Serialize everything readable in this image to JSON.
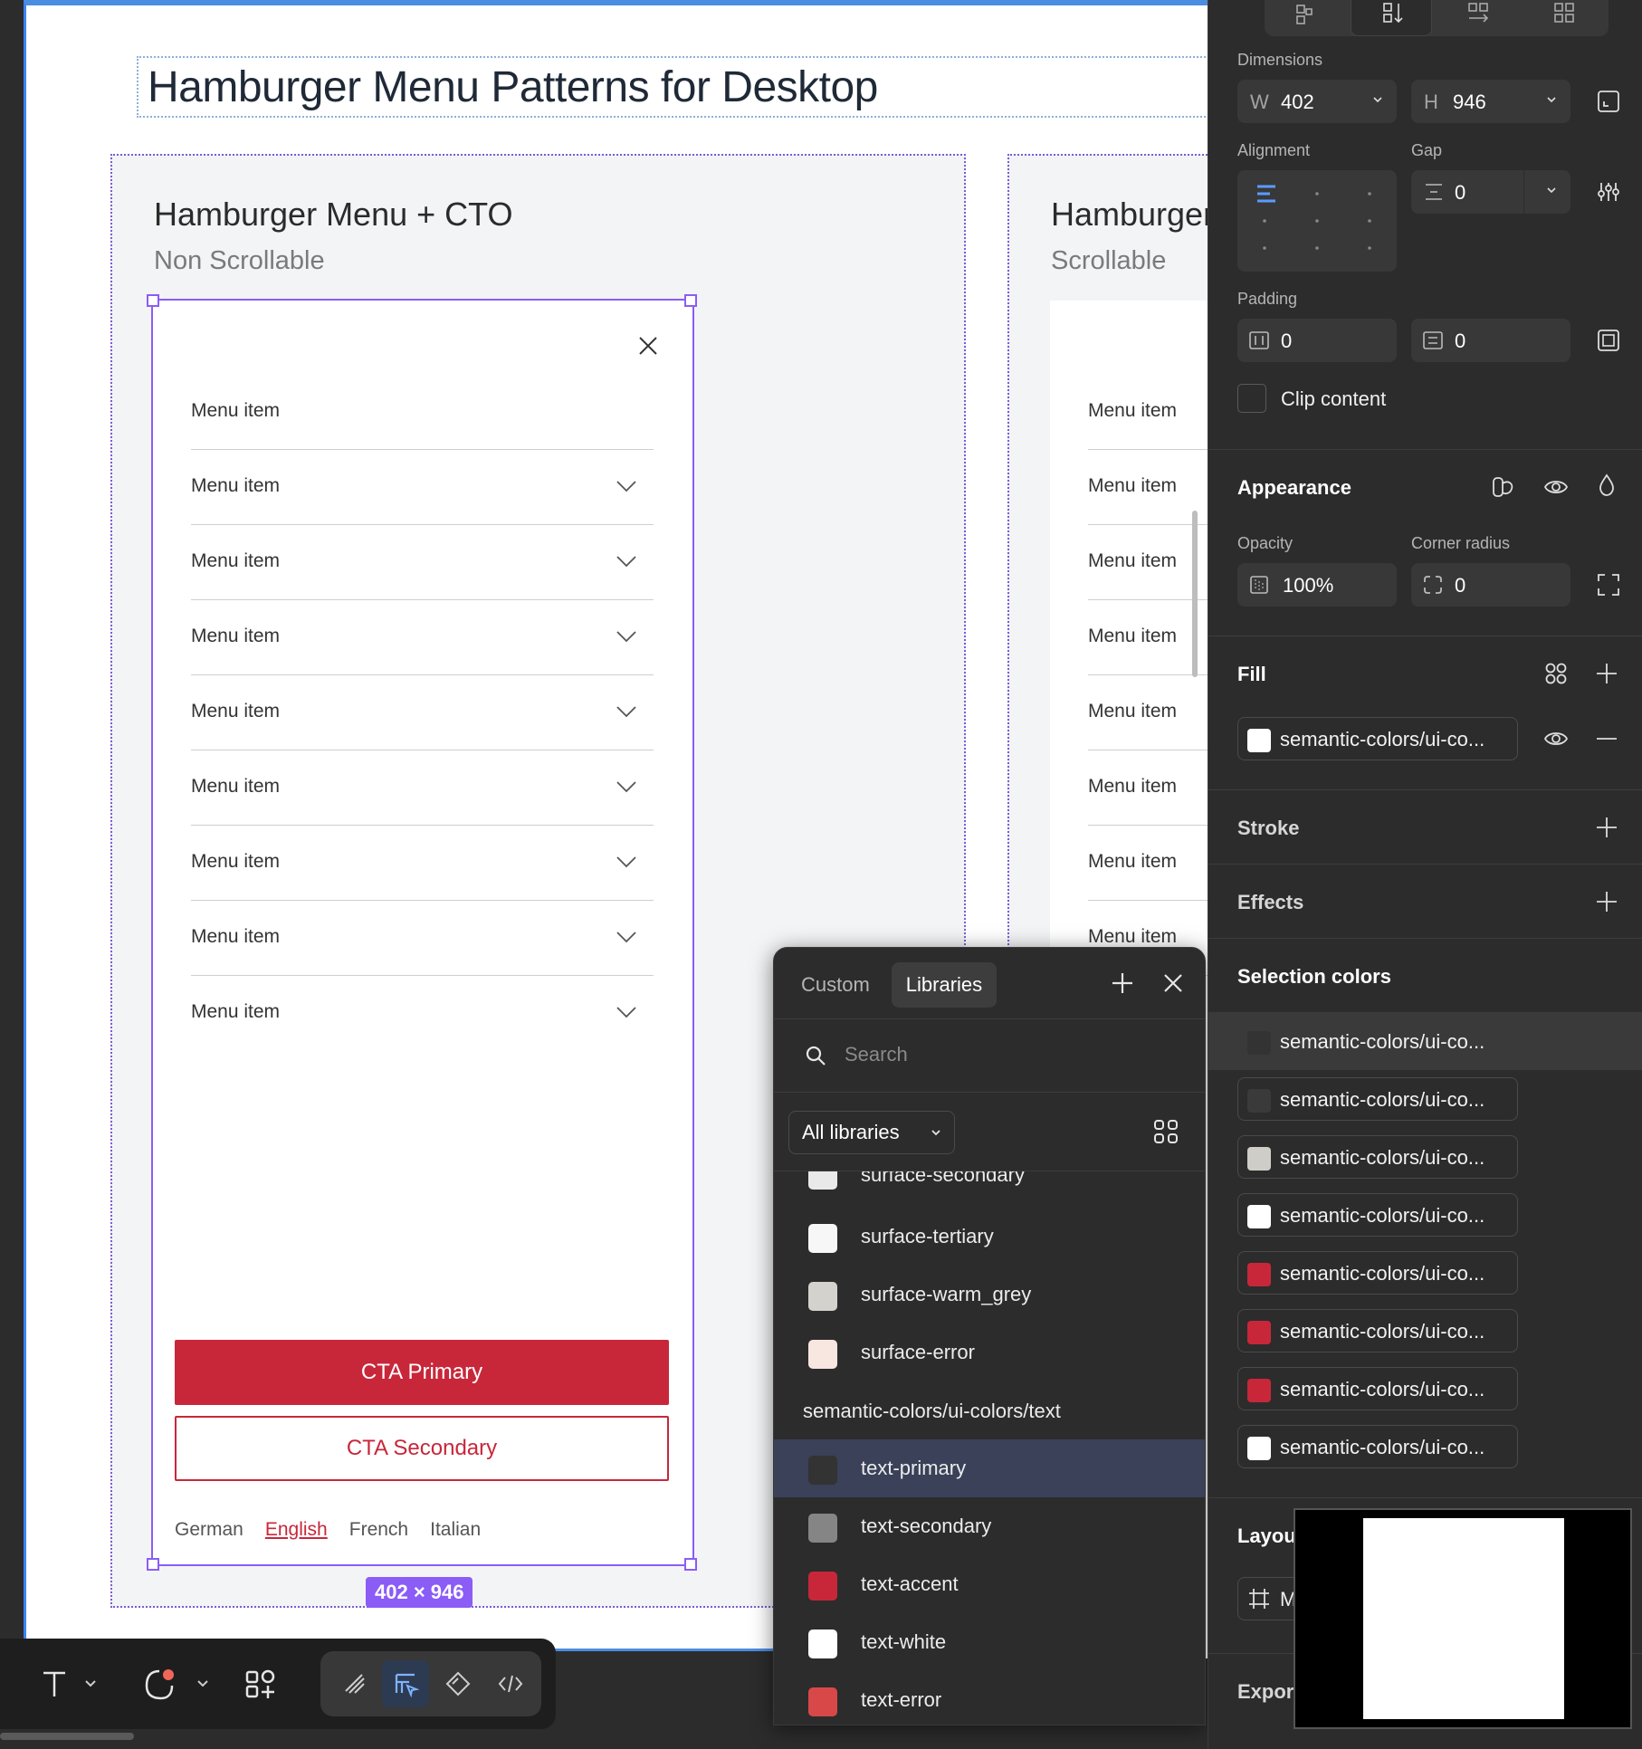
{
  "canvas": {
    "page_title": "Hamburger Menu Patterns for Desktop",
    "frame_a": {
      "title": "Hamburger Menu + CTO",
      "subtitle": "Non Scrollable"
    },
    "frame_b": {
      "title": "Hamburger Menu",
      "subtitle": "Scrollable"
    },
    "menu_items": [
      "Menu item",
      "Menu item",
      "Menu item",
      "Menu item",
      "Menu item",
      "Menu item",
      "Menu item",
      "Menu item",
      "Menu item"
    ],
    "cta_primary": "CTA Primary",
    "cta_secondary": "CTA Secondary",
    "languages": [
      "German",
      "English",
      "French",
      "Italian"
    ],
    "active_language": "English",
    "size_badge": "402 × 946",
    "brand_color": "#c8273a",
    "selection_color": "#8b5cf6"
  },
  "toolbar": {
    "tools": [
      "text-tool",
      "shape-tool",
      "components-tool",
      "draw-tool",
      "dev-mode-tool",
      "prototype-tool",
      "code-tool"
    ]
  },
  "picker": {
    "tabs": [
      "Custom",
      "Libraries"
    ],
    "active_tab": "Libraries",
    "search_placeholder": "Search",
    "library_filter": "All libraries",
    "items": [
      {
        "name": "surface-secondary",
        "color": "#e9e9e9"
      },
      {
        "name": "surface-tertiary",
        "color": "#f7f7f7"
      },
      {
        "name": "surface-warm_grey",
        "color": "#d4d2cd"
      },
      {
        "name": "surface-error",
        "color": "#f8e6e0"
      }
    ],
    "group": "semantic-colors/ui-colors/text",
    "text_items": [
      {
        "name": "text-primary",
        "color": "#333333"
      },
      {
        "name": "text-secondary",
        "color": "#858585"
      },
      {
        "name": "text-accent",
        "color": "#c8273a"
      },
      {
        "name": "text-white",
        "color": "#ffffff"
      },
      {
        "name": "text-error",
        "color": "#d94848"
      }
    ],
    "selected": "text-primary"
  },
  "panel": {
    "dimensions": {
      "label": "Dimensions",
      "w_prefix": "W",
      "w": "402",
      "h_prefix": "H",
      "h": "946"
    },
    "alignment": {
      "label": "Alignment"
    },
    "gap": {
      "label": "Gap",
      "value": "0"
    },
    "padding": {
      "label": "Padding",
      "horizontal": "0",
      "vertical": "0"
    },
    "clip_content": "Clip content",
    "appearance": {
      "label": "Appearance",
      "opacity_label": "Opacity",
      "opacity": "100%",
      "radius_label": "Corner radius",
      "radius": "0"
    },
    "fill": {
      "label": "Fill",
      "name": "semantic-colors/ui-co...",
      "color": "#ffffff"
    },
    "stroke": "Stroke",
    "effects": "Effects",
    "selection_colors": {
      "label": "Selection colors",
      "items": [
        {
          "name": "semantic-colors/ui-co...",
          "color": "#333333"
        },
        {
          "name": "semantic-colors/ui-co...",
          "color": "#3a3a3a"
        },
        {
          "name": "semantic-colors/ui-co...",
          "color": "#cfcdc8"
        },
        {
          "name": "semantic-colors/ui-co...",
          "color": "#ffffff"
        },
        {
          "name": "semantic-colors/ui-co...",
          "color": "#c8273a"
        },
        {
          "name": "semantic-colors/ui-co...",
          "color": "#c8273a"
        },
        {
          "name": "semantic-colors/ui-co...",
          "color": "#c8273a"
        },
        {
          "name": "semantic-colors/ui-co...",
          "color": "#ffffff"
        }
      ]
    },
    "layout_label": "Layou",
    "layout_field": "M",
    "export_label": "Expor"
  }
}
